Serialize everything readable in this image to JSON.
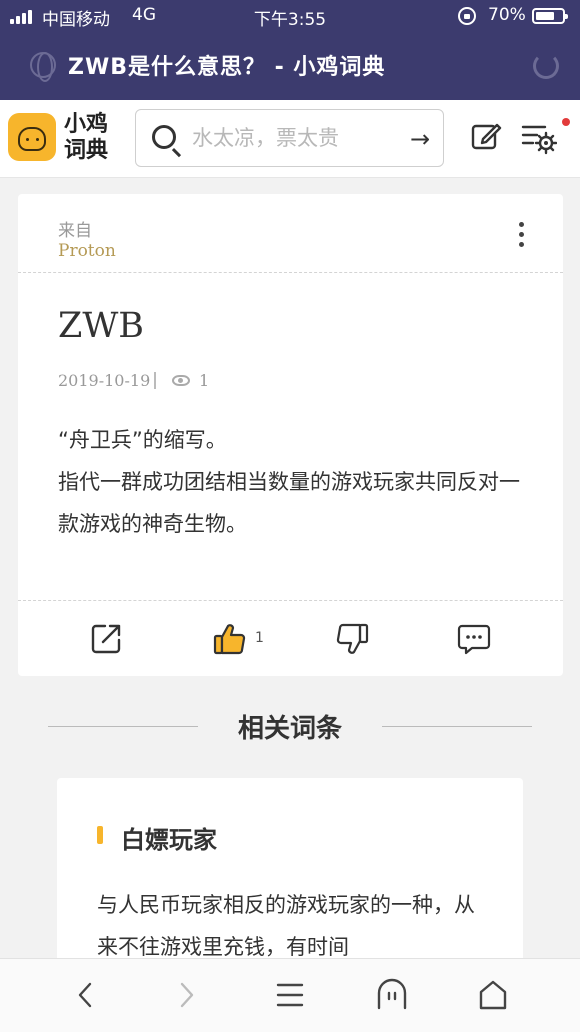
{
  "status_bar": {
    "carrier": "中国移动",
    "network": "4G",
    "time": "下午3:55",
    "battery_percent": "70%",
    "battery_level": 0.7
  },
  "browser": {
    "page_title": "ZWB是什么意思？ - 小鸡词典"
  },
  "app_header": {
    "logo_text": "小鸡词典",
    "search_placeholder": "水太凉，票太贵",
    "has_notification_dot": true
  },
  "entry": {
    "from_label": "来自",
    "author": "Proton",
    "word": "ZWB",
    "date": "2019-10-19",
    "views": "1",
    "definition_lines": [
      "“舟卫兵”的缩写。",
      "指代一群成功团结相当数量的游戏玩家共同反对一款游戏的神奇生物。"
    ],
    "actions": {
      "like_count": "1"
    }
  },
  "related": {
    "section_title": "相关词条",
    "items": [
      {
        "title": "白嫖玩家",
        "text": "与人民币玩家相反的游戏玩家的一种，从来不往游戏里充钱，有时间"
      }
    ]
  },
  "colors": {
    "topbar": "#3c3b6e",
    "brand_yellow": "#f7b52c",
    "author_gold": "#b59a55",
    "notification_red": "#e23b3b"
  },
  "icons": {
    "nav": [
      "back-icon",
      "forward-icon",
      "menu-icon",
      "multi-window-icon",
      "home-icon"
    ],
    "actions": [
      "share-icon",
      "thumbs-up-icon",
      "thumbs-down-icon",
      "comment-icon"
    ]
  }
}
